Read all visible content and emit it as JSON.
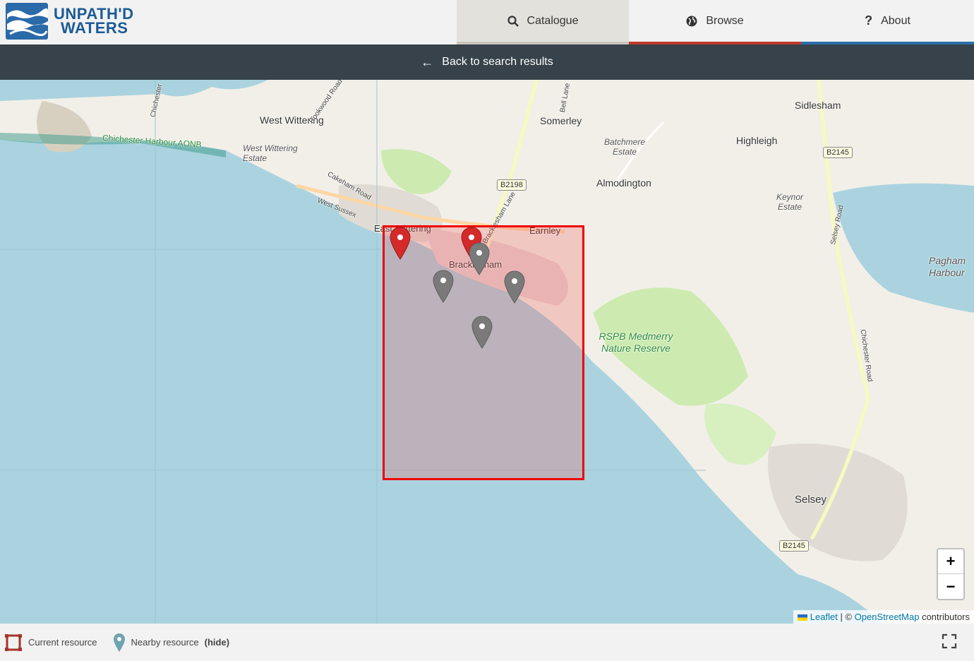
{
  "header": {
    "logo_line1": "UNPATH'D",
    "logo_line2": "WATERS",
    "nav": [
      {
        "label": "Catalogue",
        "icon": "search-icon"
      },
      {
        "label": "Browse",
        "icon": "globe-icon"
      },
      {
        "label": "About",
        "icon": "question-icon"
      }
    ]
  },
  "backbar": {
    "label": "Back to search results",
    "icon": "arrow-left-icon"
  },
  "map": {
    "places": {
      "west_wittering": "West Wittering",
      "somerley": "Somerley",
      "sidlesham": "Sidlesham",
      "highleigh": "Highleigh",
      "almodington": "Almodington",
      "earnley": "Earnley",
      "east_wittering": "East Wittering",
      "bracklesham": "Bracklesham",
      "selsey": "Selsey",
      "west_wittering_estate": "West Wittering Estate",
      "batchmere_estate": "Batchmere Estate",
      "keynor_estate": "Keynor Estate",
      "pagham_harbour": "Pagham Harbour",
      "rspb": "RSPB Medmerry Nature Reserve",
      "aonb": "Chichester Harbour AONB",
      "west_sussex": "West Sussex",
      "cakeham_road": "Cakeham Road",
      "rookwood_road": "Rookwood Road",
      "bell_lane": "Bell Lane",
      "bracklesham_lane": "Bracklesham Lane",
      "selsey_road": "Selsey Road",
      "chichester_road": "Chichester Road",
      "chichester": "Chichester"
    },
    "shields": {
      "b2198": "B2198",
      "b2145_north": "B2145",
      "b2145_south": "B2145"
    },
    "colors": {
      "current_resource": "#ee0000",
      "nearby_pin": "#7a7a7a",
      "current_pin": "#d42a2a"
    },
    "zoom_in": "+",
    "zoom_out": "−",
    "attribution": {
      "leaflet": "Leaflet",
      "sep": "| ©",
      "osm": "OpenStreetMap",
      "contributors": "contributors"
    }
  },
  "footer": {
    "current_label": "Current resource",
    "nearby_label": "Nearby resource",
    "hide_label": "(hide)"
  }
}
